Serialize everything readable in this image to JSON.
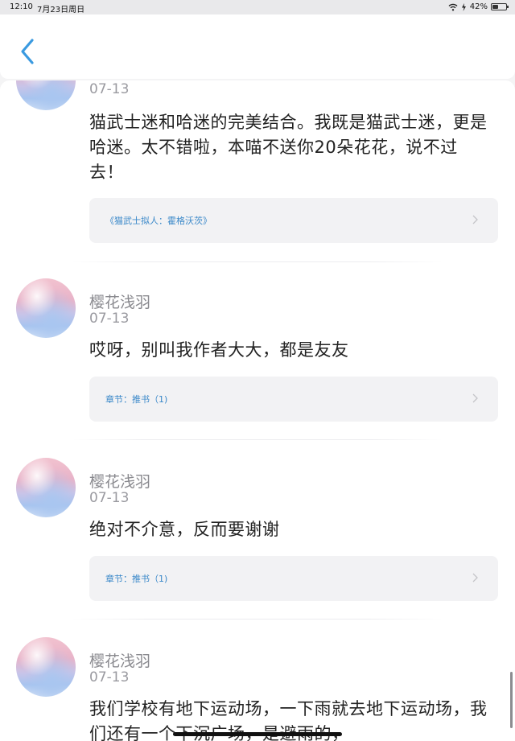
{
  "status_bar": {
    "time": "12:10",
    "date": "7月23日周日",
    "battery": "42%",
    "battery_level": 0.42
  },
  "nav": {
    "back_icon": "chevron-left-icon",
    "accent_color": "#3a9ae0"
  },
  "comments": [
    {
      "username": "",
      "date": "07-13",
      "text": "猫武士迷和哈迷的完美结合。我既是猫武士迷，更是哈迷。太不错啦，本喵不送你20朵花花，说不过去！",
      "ref": "《猫武士拟人：霍格沃茨》"
    },
    {
      "username": "樱花浅羽",
      "date": "07-13",
      "text": "哎呀，别叫我作者大大，都是友友",
      "ref": "章节：推书（1)"
    },
    {
      "username": "樱花浅羽",
      "date": "07-13",
      "text": "绝对不介意，反而要谢谢",
      "ref": "章节：推书（1)"
    },
    {
      "username": "樱花浅羽",
      "date": "07-13",
      "text": "我们学校有地下运动场，一下雨就去地下运动场，我们还有一个下沉广场，是避雨的，",
      "ref": ""
    }
  ]
}
